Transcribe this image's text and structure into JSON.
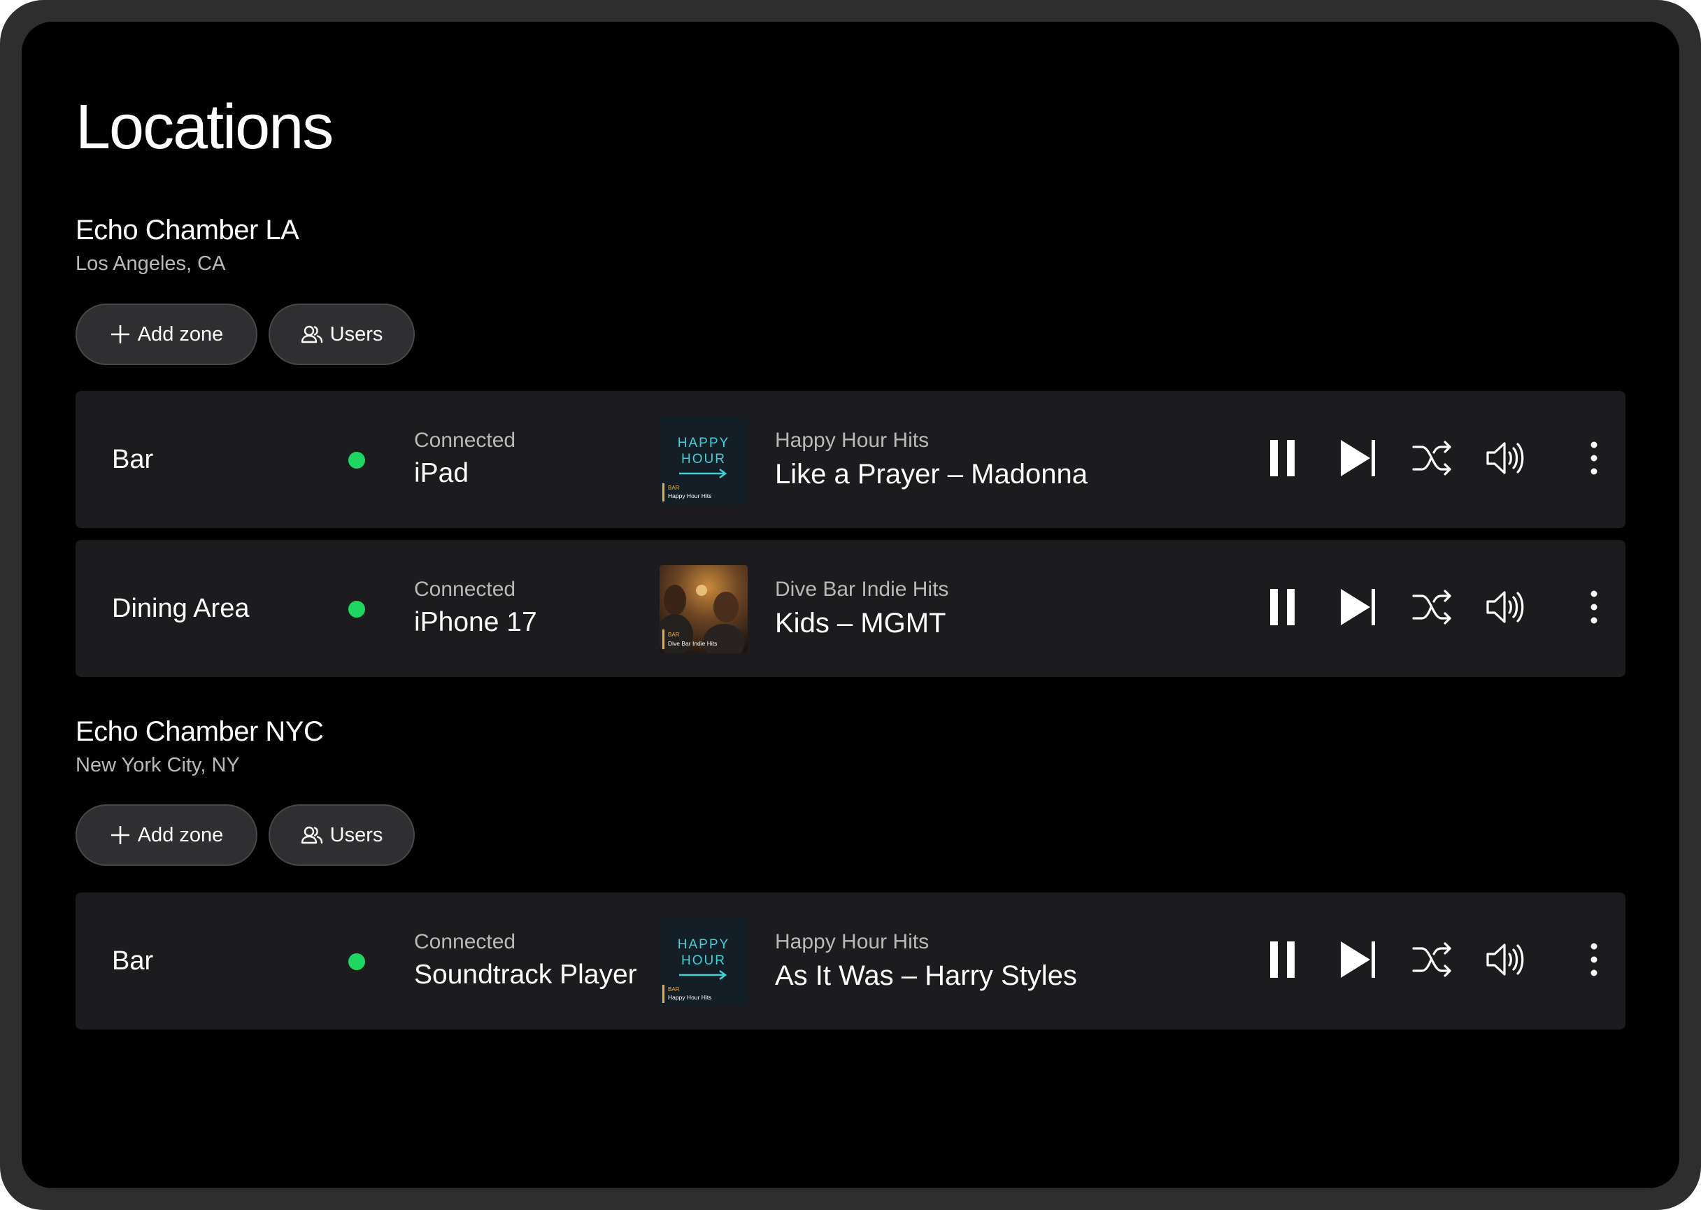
{
  "page": {
    "title": "Locations"
  },
  "locations": [
    {
      "name": "Echo Chamber LA",
      "city": "Los Angeles, CA",
      "add_zone_label": "Add zone",
      "users_label": "Users",
      "zones": [
        {
          "name": "Bar",
          "status": "Connected",
          "device": "iPad",
          "playlist": "Happy Hour Hits",
          "track": "Like a Prayer – Madonna",
          "art": {
            "line1": "HAPPY",
            "line2": "HOUR",
            "tag": "BAR",
            "caption": "Happy Hour Hits"
          }
        },
        {
          "name": "Dining Area",
          "status": "Connected",
          "device": "iPhone 17",
          "playlist": "Dive Bar Indie Hits",
          "track": "Kids – MGMT",
          "art": {
            "tag": "BAR",
            "caption": "Dive Bar Indie Hits"
          }
        }
      ]
    },
    {
      "name": "Echo Chamber NYC",
      "city": "New York City, NY",
      "add_zone_label": "Add zone",
      "users_label": "Users",
      "zones": [
        {
          "name": "Bar",
          "status": "Connected",
          "device": "Soundtrack Player",
          "playlist": "Happy Hour Hits",
          "track": "As It Was – Harry Styles",
          "art": {
            "line1": "HAPPY",
            "line2": "HOUR",
            "tag": "BAR",
            "caption": "Happy Hour Hits"
          }
        }
      ]
    }
  ],
  "icons": {
    "add": "plus-icon",
    "users": "users-icon",
    "pause": "pause-icon",
    "next": "skip-next-icon",
    "shuffle": "shuffle-icon",
    "volume": "volume-icon",
    "more": "more-vertical-icon"
  },
  "colors": {
    "background": "#000000",
    "device_frame": "#2e2e2e",
    "zone_card": "#1c1c1e",
    "pill": "#2f2f31",
    "status_connected": "#1ed760",
    "secondary_text": "#b9b9b9",
    "neon": "#3fd1d6"
  }
}
